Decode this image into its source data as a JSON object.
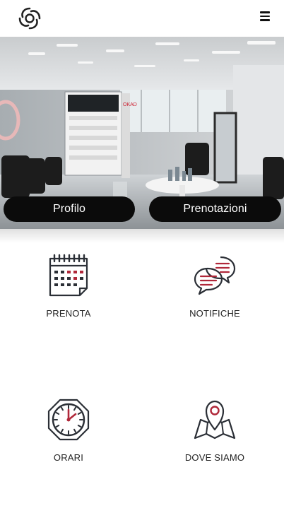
{
  "header": {
    "logo_icon": "swirl-logo-icon",
    "menu_icon": "hamburger-menu-icon"
  },
  "hero": {
    "image": "salon-interior-photo"
  },
  "buttons": {
    "profile_label": "Profilo",
    "bookings_label": "Prenotazioni"
  },
  "tiles": [
    {
      "label": "PRENOTA",
      "icon": "calendar-icon"
    },
    {
      "label": "NOTIFICHE",
      "icon": "chat-bubbles-icon"
    },
    {
      "label": "ORARI",
      "icon": "clock-icon"
    },
    {
      "label": "DOVE SIAMO",
      "icon": "map-pin-icon"
    }
  ],
  "colors": {
    "accent": "#b0283a",
    "icon_stroke": "#2b2f36",
    "button_bg": "#0b0b0b"
  }
}
